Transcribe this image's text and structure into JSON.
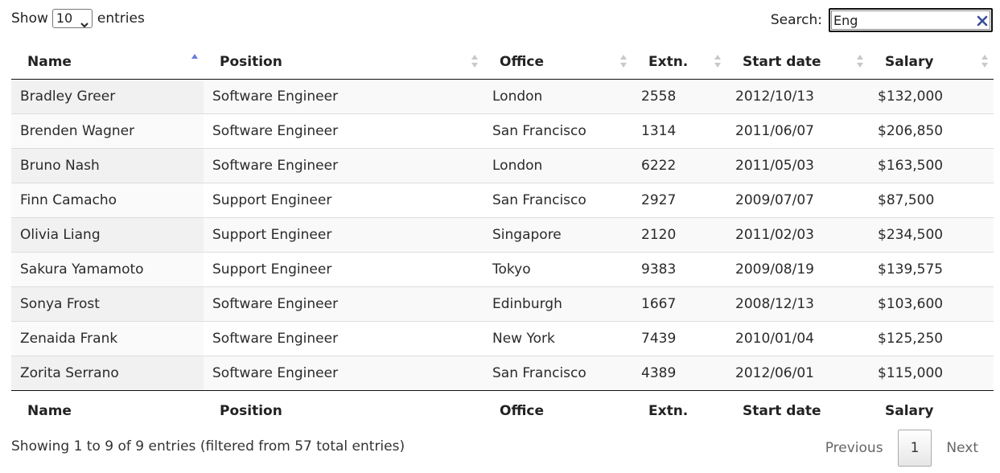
{
  "length_menu": {
    "prefix": "Show",
    "value": "10",
    "suffix": "entries",
    "caret_icon": "chevron-down-icon"
  },
  "search": {
    "label": "Search:",
    "value": "Eng",
    "clear_icon": "close-icon",
    "clear_color": "#3b4f9a"
  },
  "table": {
    "headers": [
      "Name",
      "Position",
      "Office",
      "Extn.",
      "Start date",
      "Salary"
    ],
    "sort_active_color": "#6c7ae0",
    "sort_inactive_color": "#c8c8c8",
    "rows": [
      [
        "Bradley Greer",
        "Software Engineer",
        "London",
        "2558",
        "2012/10/13",
        "$132,000"
      ],
      [
        "Brenden Wagner",
        "Software Engineer",
        "San Francisco",
        "1314",
        "2011/06/07",
        "$206,850"
      ],
      [
        "Bruno Nash",
        "Software Engineer",
        "London",
        "6222",
        "2011/05/03",
        "$163,500"
      ],
      [
        "Finn Camacho",
        "Support Engineer",
        "San Francisco",
        "2927",
        "2009/07/07",
        "$87,500"
      ],
      [
        "Olivia Liang",
        "Support Engineer",
        "Singapore",
        "2120",
        "2011/02/03",
        "$234,500"
      ],
      [
        "Sakura Yamamoto",
        "Support Engineer",
        "Tokyo",
        "9383",
        "2009/08/19",
        "$139,575"
      ],
      [
        "Sonya Frost",
        "Software Engineer",
        "Edinburgh",
        "1667",
        "2008/12/13",
        "$103,600"
      ],
      [
        "Zenaida Frank",
        "Software Engineer",
        "New York",
        "7439",
        "2010/01/04",
        "$125,250"
      ],
      [
        "Zorita Serrano",
        "Software Engineer",
        "San Francisco",
        "4389",
        "2012/06/01",
        "$115,000"
      ]
    ]
  },
  "info": "Showing 1 to 9 of 9 entries (filtered from 57 total entries)",
  "pagination": {
    "previous": "Previous",
    "current": "1",
    "next": "Next"
  }
}
